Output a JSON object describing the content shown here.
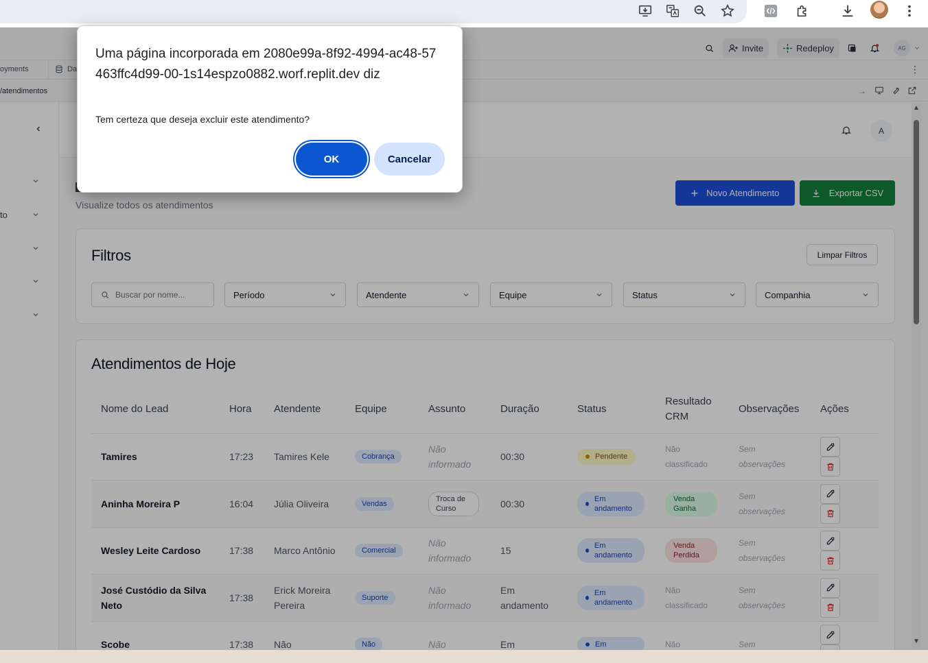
{
  "dialog": {
    "title": "Uma página incorporada em 2080e99a-8f92-4994-ac48-57463ffc4d99-00-1s14espzo0882.worf.replit.dev diz",
    "message": "Tem certeza que deseja excluir este atendimento?",
    "ok_label": "OK",
    "cancel_label": "Cancelar"
  },
  "replit": {
    "invite_label": "Invite",
    "redeploy_label": "Redeploy",
    "user_initials": "AG",
    "tabs": [
      "oyments",
      "Da"
    ],
    "url_path": "/atendimentos"
  },
  "app": {
    "subtitle": "Visualize todos os atendimentos",
    "avatar_initial": "A",
    "sidebar_partial_label": "to",
    "new_button": "Novo Atendimento",
    "export_button": "Exportar CSV"
  },
  "filters": {
    "title": "Filtros",
    "clear_label": "Limpar Filtros",
    "search_placeholder": "Buscar por nome...",
    "selects": [
      "Período",
      "Atendente",
      "Equipe",
      "Status",
      "Companhia"
    ]
  },
  "table": {
    "title": "Atendimentos de Hoje",
    "headers": [
      "Nome do Lead",
      "Hora",
      "Atendente",
      "Equipe",
      "Assunto",
      "Duração",
      "Status",
      "Resultado CRM",
      "Observações",
      "Ações"
    ],
    "rows": [
      {
        "name": "Tamires",
        "hora": "17:23",
        "atendente": "Tamires Kele",
        "equipe": "Cobrança",
        "assunto": "Não informado",
        "duracao": "00:30",
        "status": "Pendente",
        "crm": "Não classificado",
        "obs": "Sem observações"
      },
      {
        "name": "Aninha Moreira P",
        "hora": "16:04",
        "atendente": "Júlia Oliveira",
        "equipe": "Vendas",
        "assunto": "Troca de Curso",
        "duracao": "00:30",
        "status": "Em andamento",
        "crm": "Venda Ganha",
        "obs": "Sem observações"
      },
      {
        "name": "Wesley Leite Cardoso",
        "hora": "17:38",
        "atendente": "Marco Antônio",
        "equipe": "Comercial",
        "assunto": "Não informado",
        "duracao": "15",
        "status": "Em andamento",
        "crm": "Venda Perdida",
        "obs": "Sem observações"
      },
      {
        "name": "José Custódio da Silva Neto",
        "hora": "17:38",
        "atendente": "Erick Moreira Pereira",
        "equipe": "Suporte",
        "assunto": "Não informado",
        "duracao": "Em andamento",
        "status": "Em andamento",
        "crm": "Não classificado",
        "obs": "Sem observações"
      },
      {
        "name": "Scobe",
        "hora": "17:38",
        "atendente": "Não",
        "equipe": "Não",
        "assunto": "Não",
        "duracao": "Em",
        "status": "Em",
        "crm": "Não",
        "obs": "Sem"
      }
    ]
  },
  "colors": {
    "primary": "#1d4ed8",
    "export": "#15803d",
    "dialog_ok": "#0b57d0",
    "dialog_cancel": "#d3e3fd"
  }
}
